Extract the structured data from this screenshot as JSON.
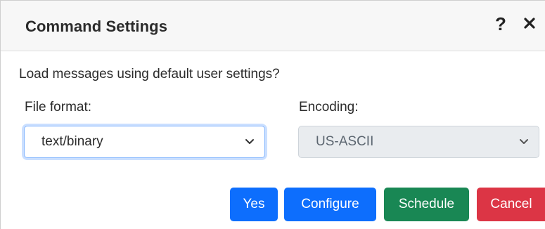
{
  "dialog": {
    "title": "Command Settings",
    "help_symbol": "?",
    "prompt": "Load messages using default user settings?"
  },
  "file_format": {
    "label": "File format:",
    "value": "text/binary"
  },
  "encoding": {
    "label": "Encoding:",
    "value": "US-ASCII",
    "disabled": true
  },
  "buttons": {
    "yes": "Yes",
    "configure": "Configure",
    "schedule": "Schedule",
    "cancel": "Cancel"
  },
  "colors": {
    "primary": "#0d6efd",
    "success": "#198754",
    "danger": "#dc3545",
    "header_bg": "#f7f7f7"
  },
  "icons": {
    "help": "question-mark-icon",
    "close": "close-x-icon",
    "dropdown": "chevron-down-icon"
  }
}
